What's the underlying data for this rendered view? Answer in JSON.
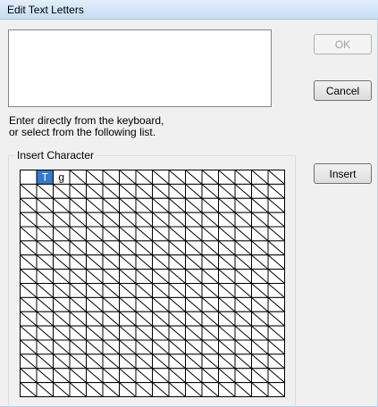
{
  "window": {
    "title": "Edit Text Letters"
  },
  "text_input": {
    "value": ""
  },
  "buttons": {
    "ok": "OK",
    "cancel": "Cancel",
    "insert": "Insert"
  },
  "instructions": {
    "line1": "Enter directly from the keyboard,",
    "line2": "or select from the following list."
  },
  "insert_group": {
    "label": "Insert Character",
    "characters": [
      "",
      "T",
      "g"
    ],
    "selected_index": 1,
    "columns": 16,
    "rows": 16
  },
  "colors": {
    "selection": "#3778c8",
    "grid_line": "#000000"
  }
}
